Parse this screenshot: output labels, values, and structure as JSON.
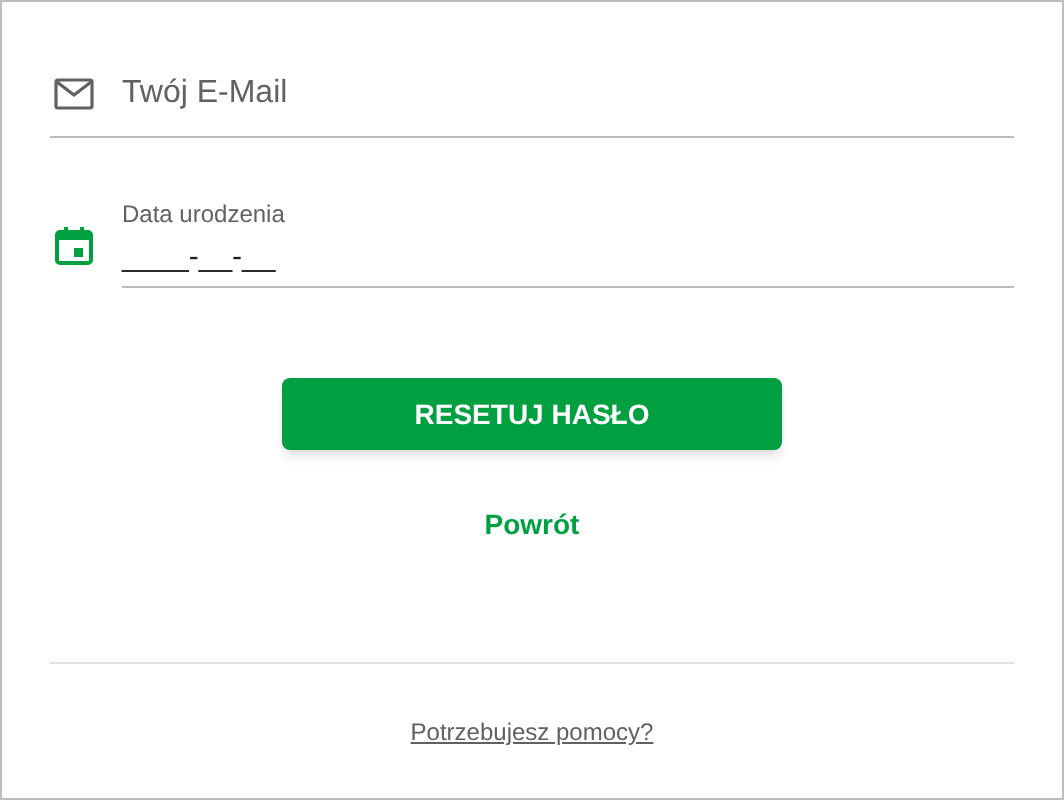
{
  "email_field": {
    "placeholder": "Twój E-Mail"
  },
  "birthdate_field": {
    "label": "Data urodzenia",
    "value": "____-__-__"
  },
  "reset_button": {
    "label": "RESETUJ HASŁO"
  },
  "back_link": {
    "label": "Powrót"
  },
  "help_link": {
    "label": "Potrzebujesz pomocy?"
  }
}
